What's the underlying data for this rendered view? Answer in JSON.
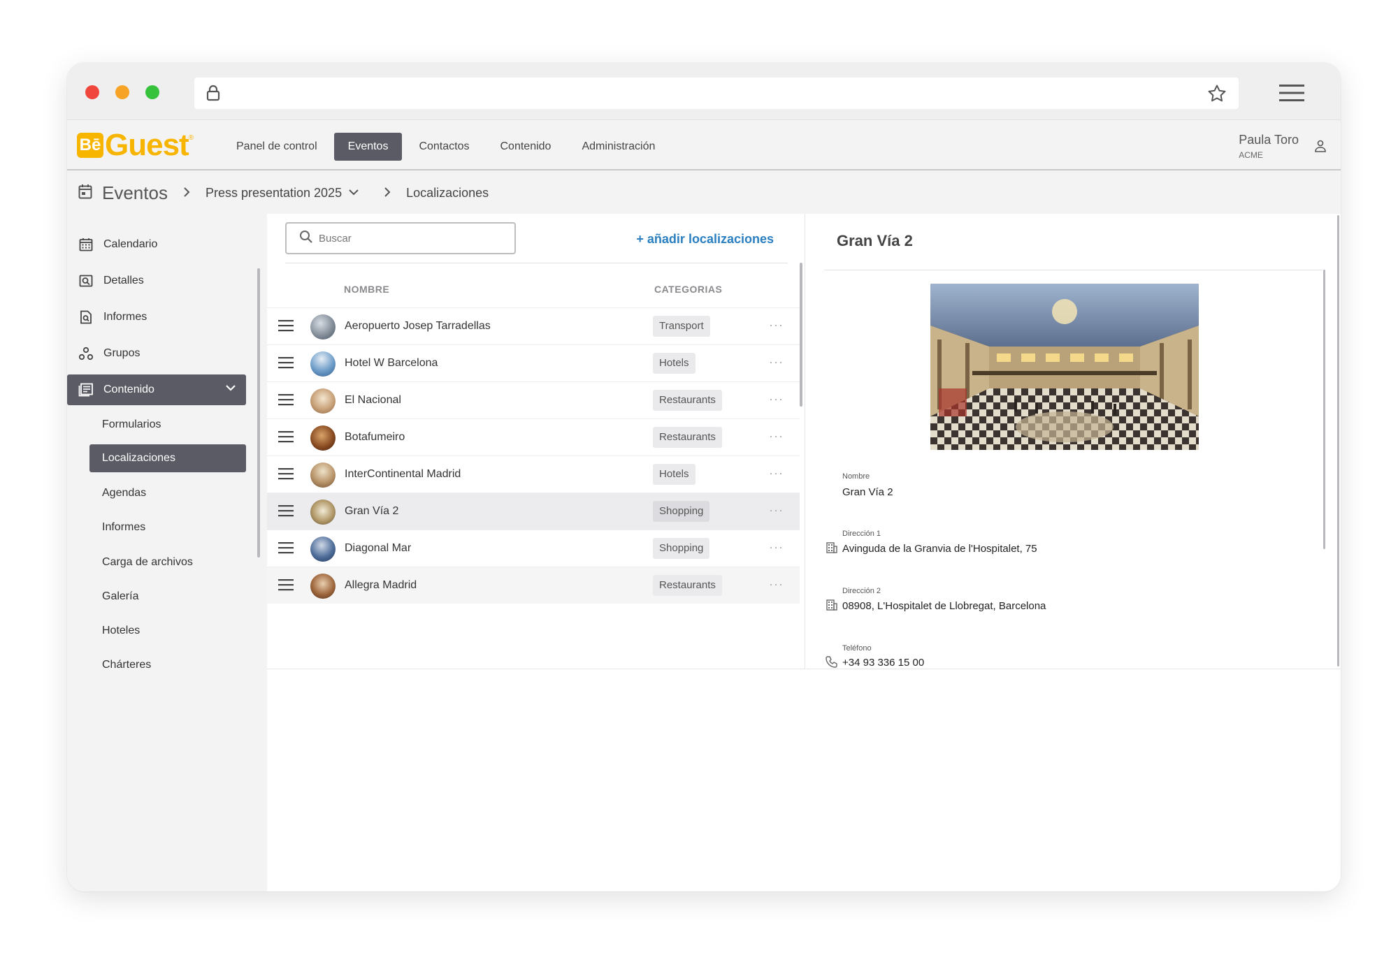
{
  "browser": {
    "lock_icon": "lock-icon",
    "star_icon": "star-icon",
    "menu_icon": "hamburger-menu-icon"
  },
  "colors": {
    "brand": "#f7b500",
    "active_nav": "#5a5b64",
    "link": "#2a7fc1"
  },
  "app": {
    "logo_be": "Bē",
    "logo_text": "Guest",
    "logo_reg": "®",
    "nav": [
      {
        "label": "Panel de control"
      },
      {
        "label": "Eventos"
      },
      {
        "label": "Contactos"
      },
      {
        "label": "Contenido"
      },
      {
        "label": "Administración"
      }
    ],
    "user": {
      "name": "Paula Toro",
      "org": "ACME"
    }
  },
  "breadcrumb": {
    "root": "Eventos",
    "event": "Press presentation 2025",
    "current": "Localizaciones"
  },
  "sidebar": {
    "items": [
      {
        "label": "Calendario",
        "icon": "calendar-icon"
      },
      {
        "label": "Detalles",
        "icon": "details-icon"
      },
      {
        "label": "Informes",
        "icon": "report-icon"
      },
      {
        "label": "Grupos",
        "icon": "groups-icon"
      },
      {
        "label": "Contenido",
        "icon": "content-icon"
      }
    ],
    "subitems": [
      {
        "label": "Formularios"
      },
      {
        "label": "Localizaciones"
      },
      {
        "label": "Agendas"
      },
      {
        "label": "Informes"
      },
      {
        "label": "Carga de archivos"
      },
      {
        "label": "Galería"
      },
      {
        "label": "Hoteles"
      },
      {
        "label": "Chárteres"
      }
    ]
  },
  "list": {
    "search_placeholder": "Buscar",
    "add_label": "+ añadir localizaciones",
    "col_name": "NOMBRE",
    "col_categories": "CATEGORIAS",
    "rows": [
      {
        "name": "Aeropuerto Josep Tarradellas",
        "category": "Transport"
      },
      {
        "name": "Hotel W Barcelona",
        "category": "Hotels"
      },
      {
        "name": "El Nacional",
        "category": "Restaurants"
      },
      {
        "name": "Botafumeiro",
        "category": "Restaurants"
      },
      {
        "name": "InterContinental Madrid",
        "category": "Hotels"
      },
      {
        "name": "Gran Vía 2",
        "category": "Shopping"
      },
      {
        "name": "Diagonal Mar",
        "category": "Shopping"
      },
      {
        "name": "Allegra Madrid",
        "category": "Restaurants"
      }
    ],
    "more": "···"
  },
  "detail": {
    "title": "Gran Vía 2",
    "name_label": "Nombre",
    "name_value": "Gran Vía 2",
    "addr1_label": "Dirección 1",
    "addr1_value": "Avinguda de la Granvia de l'Hospitalet, 75",
    "addr2_label": "Dirección 2",
    "addr2_value": "08908, L'Hospitalet de Llobregat, Barcelona",
    "phone_label": "Teléfono",
    "phone_value": "+34 93 336 15 00"
  }
}
